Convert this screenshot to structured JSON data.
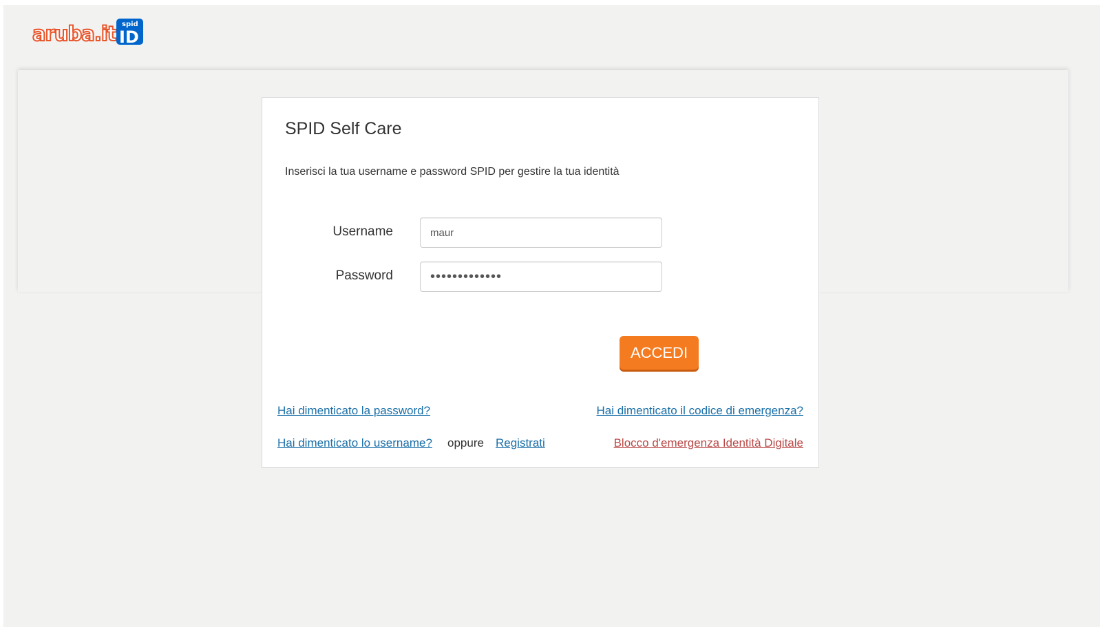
{
  "brand": {
    "logo_text": "aruba.it",
    "badge_top": "spid",
    "badge_bottom": "ID",
    "colors": {
      "aruba_orange": "#e8552a",
      "spid_blue": "#0066cc"
    }
  },
  "login_card": {
    "title": "SPID Self Care",
    "subtitle": "Inserisci la tua username e password SPID per gestire la tua identità",
    "username_label": "Username",
    "username_value": "maur",
    "password_label": "Password",
    "password_value": "•••••••••••••",
    "submit_label": "ACCEDI"
  },
  "links": {
    "forgot_password": "Hai dimenticato la password?",
    "forgot_emergency_code": "Hai dimenticato il codice di emergenza?",
    "forgot_username": "Hai dimenticato lo username?",
    "or_text": "oppure",
    "register": "Registrati",
    "emergency_block": "Blocco d'emergenza Identità Digitale"
  },
  "colors": {
    "page_background": "#f2f2f1",
    "accent_button": "#f47b20",
    "link": "#1a6fa8",
    "link_danger": "#b94a48"
  }
}
